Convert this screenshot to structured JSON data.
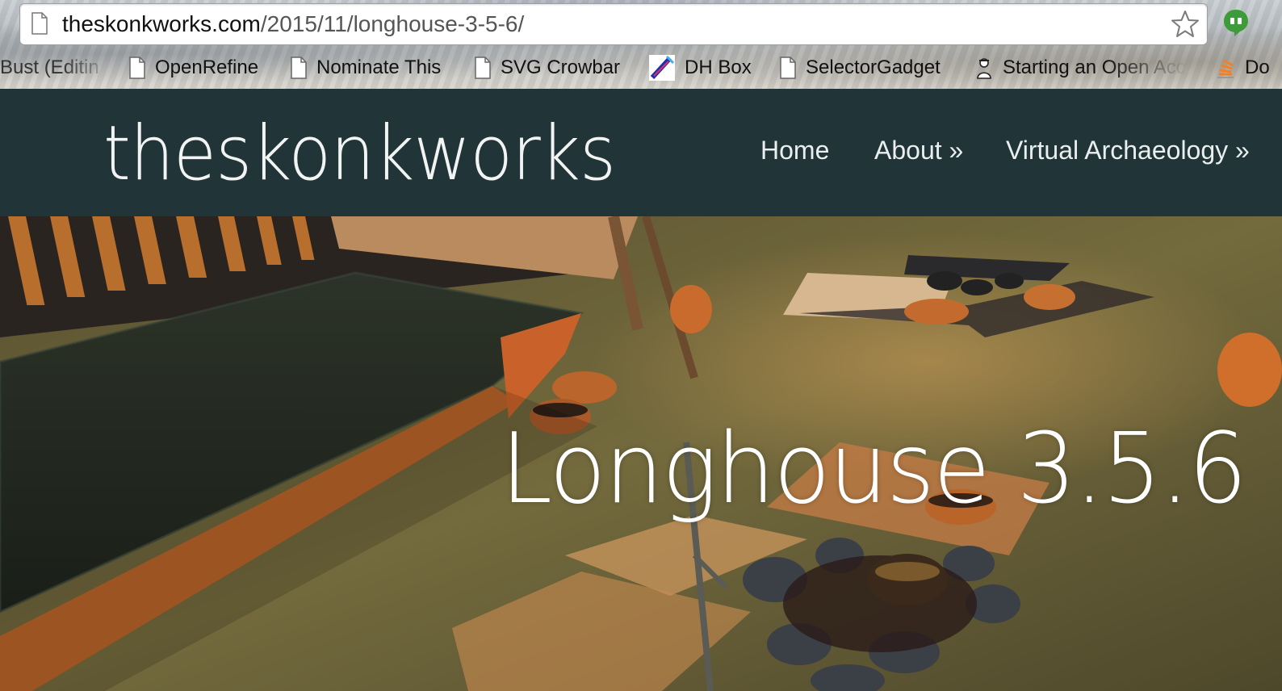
{
  "browser": {
    "url_host": "theskonkworks.com",
    "url_path": "/2015/11/longhouse-3-5-6/",
    "bookmarks": [
      {
        "label": "Bust (Editin",
        "icon": "page-icon"
      },
      {
        "label": "OpenRefine",
        "icon": "page-icon"
      },
      {
        "label": "Nominate This",
        "icon": "page-icon"
      },
      {
        "label": "SVG Crowbar",
        "icon": "page-icon"
      },
      {
        "label": "DH Box",
        "icon": "dhbox-icon"
      },
      {
        "label": "SelectorGadget",
        "icon": "page-icon"
      },
      {
        "label": "Starting an Open Acc",
        "icon": "person-icon"
      },
      {
        "label": "Do",
        "icon": "stack-icon"
      }
    ]
  },
  "site": {
    "title": "theskonkworks",
    "nav": [
      "Home",
      "About »",
      "Virtual Archaeology »"
    ]
  },
  "hero": {
    "title": "Longhouse 3.5.6"
  },
  "colors": {
    "header_bg": "#213437",
    "nav_text": "#e9eeee",
    "accent_green": "#3e9b3a"
  }
}
